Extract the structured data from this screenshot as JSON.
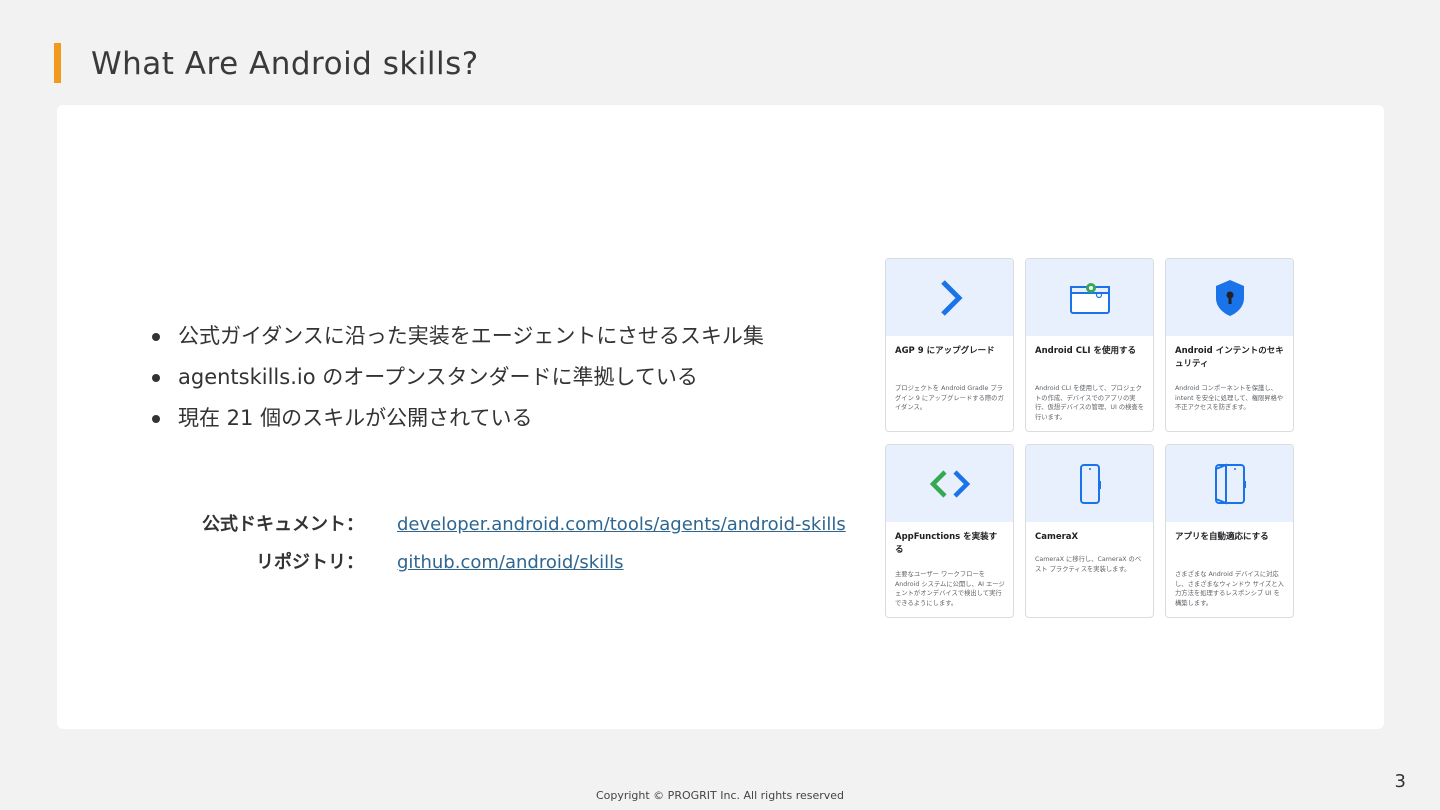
{
  "slide": {
    "title": "What Are Android skills?",
    "bullets": [
      "公式ガイダンスに沿った実装をエージェントにさせるスキル集",
      "agentskills.io のオープンスタンダードに準拠している",
      "現在 21 個のスキルが公開されている"
    ],
    "links": [
      {
        "label": "公式ドキュメント：",
        "url": "developer.android.com/tools/agents/android-skills"
      },
      {
        "label": "リポジトリ：",
        "url": "github.com/android/skills"
      }
    ],
    "skills": [
      {
        "icon": "chevron-right-icon",
        "title": "AGP 9 にアップグレード",
        "desc": "プロジェクトを Android Gradle プラグイン 9 にアップグレードする際のガイダンス。"
      },
      {
        "icon": "browser-gear-icon",
        "title": "Android CLI を使用する",
        "desc": "Android CLI を使用して、プロジェクトの作成、デバイスでのアプリの実行、仮想デバイスの管理、UI の検査を行います。"
      },
      {
        "icon": "shield-lock-icon",
        "title": "Android インテントのセキュリティ",
        "desc": "Android コンポーネントを保護し、intent を安全に処理して、権限昇格や不正アクセスを防ぎます。"
      },
      {
        "icon": "code-brackets-icon",
        "title": "AppFunctions を実装する",
        "desc": "主要なユーザー ワークフローを Android システムに公開し、AI エージェントがオンデバイスで検出して実行できるようにします。"
      },
      {
        "icon": "phone-icon",
        "title": "CameraX",
        "desc": "CameraX に移行し、CameraX のベスト プラクティスを実装します。"
      },
      {
        "icon": "foldable-phone-icon",
        "title": "アプリを自動適応にする",
        "desc": "さまざまな Android デバイスに対応し、さまざまなウィンドウ サイズと入力方法を処理するレスポンシブ UI を構築します。"
      }
    ],
    "footer": "Copyright © PROGRIT Inc. All rights reserved",
    "page_number": "3",
    "colors": {
      "accent": "#f39a1e",
      "link": "#2f6690",
      "tile_header": "#e8f0fe",
      "icon_blue": "#1a73e8",
      "icon_green": "#34a853"
    }
  }
}
